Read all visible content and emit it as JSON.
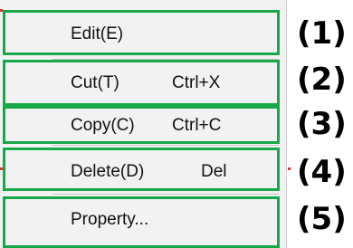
{
  "menu": {
    "items": [
      {
        "label": "Edit(E)",
        "shortcut": ""
      },
      {
        "label": "Cut(T)",
        "shortcut": "Ctrl+X"
      },
      {
        "label": "Copy(C)",
        "shortcut": "Ctrl+C"
      },
      {
        "label": "Delete(D)",
        "shortcut": "Del"
      },
      {
        "label": "Property...",
        "shortcut": ""
      }
    ]
  },
  "annotations": [
    "(1)",
    "(2)",
    "(3)",
    "(4)",
    "(5)"
  ],
  "colors": {
    "highlight_border": "#17a84a",
    "menu_background": "#f2f2f2",
    "separator": "#c8c8c8"
  }
}
